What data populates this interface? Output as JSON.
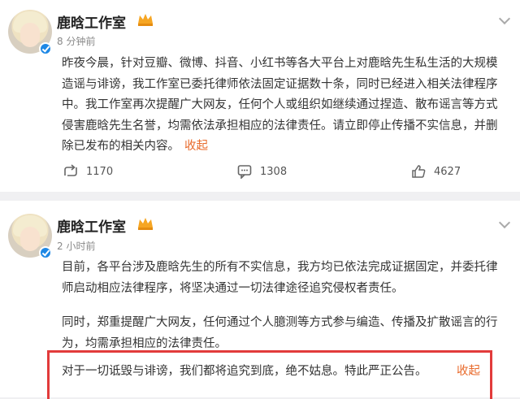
{
  "posts": [
    {
      "author": "鹿晗工作室",
      "time": "8 分钟前",
      "text": "昨夜今晨，针对豆瓣、微博、抖音、小红书等各大平台上对鹿晗先生私生活的大规模造谣与诽谤，我工作室已委托律师依法固定证据数十条，同时已经进入相关法律程序中。我工作室再次提醒广大网友，任何个人或组织如继续通过捏造、散布谣言等方式侵害鹿晗先生名誉，均需依法承担相应的法律责任。请立即停止传播不实信息，并删除已发布的相关内容。",
      "collapse_label": "收起",
      "reposts": "1170",
      "comments": "1308",
      "likes": "4627"
    },
    {
      "author": "鹿晗工作室",
      "time": "2 小时前",
      "paragraph1": "目前，各平台涉及鹿晗先生的所有不实信息，我方均已依法完成证据固定，并委托律师启动相应法律程序，将坚决通过一切法律途径追究侵权者责任。",
      "paragraph2": "同时，郑重提醒广大网友，任何通过个人臆测等方式参与编造、传播及扩散谣言的行为，均需承担相应的法律责任。",
      "highlight": "对于一切诋毁与诽谤，我们都将追究到底，绝不姑息。特此严正公告。",
      "collapse_label": "收起"
    }
  ],
  "colors": {
    "accent": "#e86a2b",
    "verified": "#1e88e5",
    "highlight_border": "#e23b3b"
  },
  "icons": [
    "verified-icon",
    "crown-badge-icon",
    "chevron-down-icon",
    "repost-icon",
    "comment-icon",
    "like-icon"
  ]
}
